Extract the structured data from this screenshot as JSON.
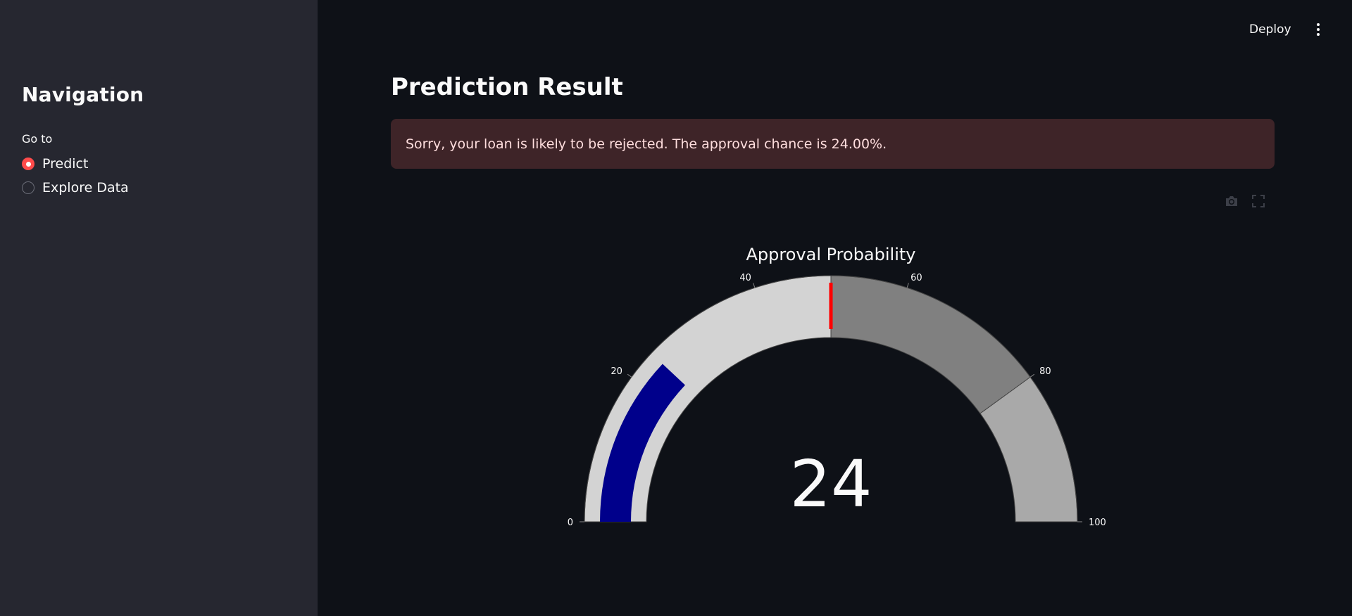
{
  "sidebar": {
    "title": "Navigation",
    "radio_label": "Go to",
    "options": [
      {
        "label": "Predict",
        "selected": true
      },
      {
        "label": "Explore Data",
        "selected": false
      }
    ]
  },
  "header": {
    "deploy_label": "Deploy",
    "menu_icon": "more-vertical-icon"
  },
  "main": {
    "title": "Prediction Result",
    "alert": {
      "text": "Sorry, your loan is likely to be rejected. The approval chance is 24.00%.",
      "type": "error"
    },
    "modebar": {
      "icons": [
        "camera-icon",
        "fullscreen-icon"
      ]
    }
  },
  "colors": {
    "app_background": "#0e1117",
    "sidebar_background": "#262730",
    "accent": "#ff4b4b",
    "alert_background": "#3e2428",
    "alert_text": "#ffdede",
    "gauge_bar": "#00008b",
    "threshold": "#ff0000",
    "step_1": "#d3d3d3",
    "step_2": "#808080",
    "step_3": "#a9a9a9"
  },
  "chart_data": {
    "type": "gauge",
    "title": "Approval Probability",
    "value": 24,
    "value_label": "24",
    "range": [
      0,
      100
    ],
    "tick_values": [
      0,
      20,
      40,
      60,
      80,
      100
    ],
    "tick_labels": [
      "0",
      "20",
      "40",
      "60",
      "80",
      "100"
    ],
    "steps": [
      {
        "range": [
          0,
          50
        ],
        "color": "#d3d3d3"
      },
      {
        "range": [
          50,
          80
        ],
        "color": "#808080"
      },
      {
        "range": [
          80,
          100
        ],
        "color": "#a9a9a9"
      }
    ],
    "bar_color": "#00008b",
    "threshold": {
      "value": 50,
      "color": "#ff0000"
    }
  }
}
